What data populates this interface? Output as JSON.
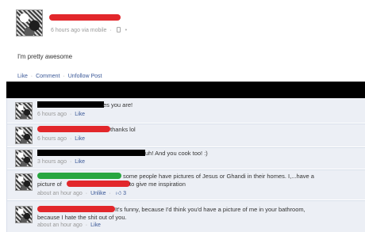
{
  "post": {
    "meta_time": "6 hours ago via mobile",
    "separator": "·",
    "status": "I'm pretty awesome",
    "actions": {
      "like": "Like",
      "comment": "Comment",
      "unfollow": "Unfollow Post",
      "dot": "·"
    }
  },
  "comments": [
    {
      "text": "es you are!",
      "time": "6 hours ago",
      "like": "Like"
    },
    {
      "text": "thanks lol",
      "time": "6 hours ago",
      "like": "Like"
    },
    {
      "text": "uh! And you cook too! :)",
      "time": "3 hours ago",
      "like": "Like"
    },
    {
      "text_line1": "some people have pictures of Jesus or Ghandi in their homes. I,...have a",
      "text_line2_prefix": "picture of",
      "text_line2_suffix": "to give me inspiration",
      "time": "about an hour ago",
      "unlike": "Unlike",
      "like_count": "3",
      "like_thumb": "thumbs-up-icon"
    },
    {
      "text_line1": "It's funny, because I'd think you'd have a picture of me in your bathroom,",
      "text_line2": "because I hate the shit out of you.",
      "time": "about an hour ago",
      "like": "Like"
    }
  ],
  "colors": {
    "link": "#3b5998",
    "comment_bg": "#eceff5",
    "redact_red": "#e2272b",
    "redact_green": "#28a640",
    "meta_gray": "#999999"
  }
}
